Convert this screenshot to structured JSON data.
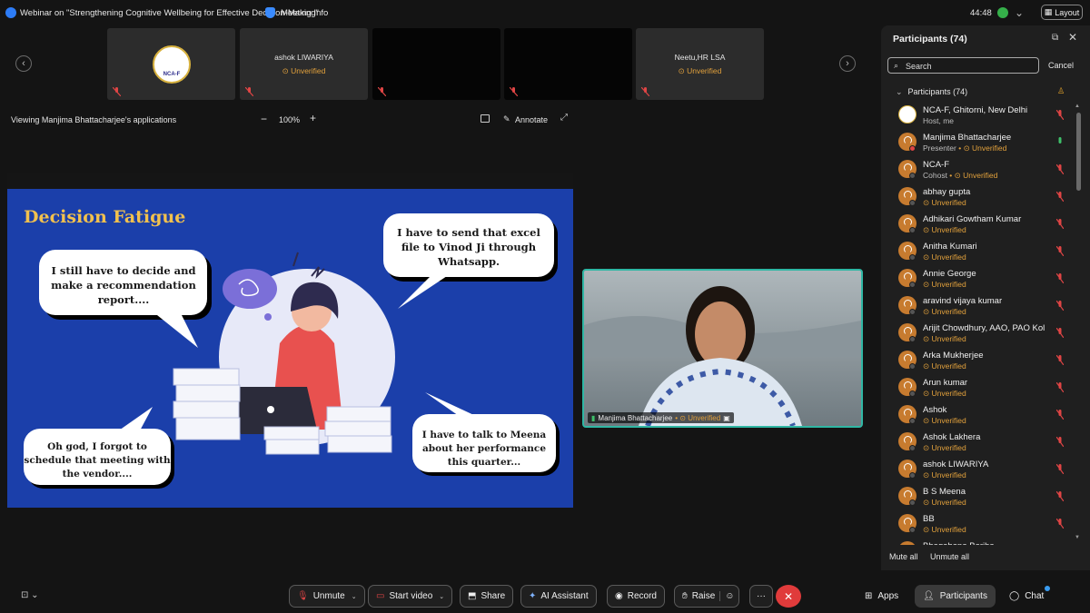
{
  "titlebar": {
    "webinar_title": "Webinar on \"Strengthening Cognitive Wellbeing for Effective Decision-Making\"",
    "meeting_info": "Meeting Info",
    "timer": "44:48",
    "layout_label": "Layout"
  },
  "filmstrip": {
    "tiles": [
      {
        "name": "",
        "status": "",
        "logo_text": "NCA-F"
      },
      {
        "name": "ashok LIWARIYA",
        "status": "Unverified"
      },
      {
        "name": "",
        "status": ""
      },
      {
        "name": "",
        "status": ""
      },
      {
        "name": "Neetu,HR LSA",
        "status": "Unverified"
      }
    ]
  },
  "viewbar": {
    "viewing_label": "Viewing Manjima Bhattacharjee's applications",
    "zoom": "100%",
    "annotate": "Annotate"
  },
  "slide": {
    "title": "Decision Fatigue",
    "bubble_top_left": [
      "I still have to decide and",
      "make a recommendation",
      "report...."
    ],
    "bubble_top_right": [
      "I have to send that excel",
      "file to Vinod Ji through",
      "Whatsapp."
    ],
    "bubble_bottom_left": [
      "Oh god, I forgot to",
      "schedule that meeting with",
      "the vendor...."
    ],
    "bubble_bottom_right": [
      "I have to talk to Meena",
      "about her performance",
      "this quarter..."
    ]
  },
  "presenter_video": {
    "name": "Manjima Bhattacharjee",
    "status": "Unverified"
  },
  "participants_panel": {
    "title": "Participants (74)",
    "search_placeholder": "Search",
    "cancel": "Cancel",
    "group_label": "Participants (74)",
    "mute_all": "Mute all",
    "unmute_all": "Unmute all",
    "items": [
      {
        "name": "NCA-F, Ghitorni, New Delhi",
        "role": "Host, me",
        "status": "",
        "host": true
      },
      {
        "name": "Manjima Bhattacharjee",
        "role": "Presenter",
        "status": "Unverified",
        "mic_on": true
      },
      {
        "name": "NCA-F",
        "role": "Cohost",
        "status": "Unverified"
      },
      {
        "name": "abhay gupta",
        "role": "",
        "status": "Unverified"
      },
      {
        "name": "Adhikari Gowtham Kumar",
        "role": "",
        "status": "Unverified"
      },
      {
        "name": "Anitha Kumari",
        "role": "",
        "status": "Unverified"
      },
      {
        "name": "Annie George",
        "role": "",
        "status": "Unverified"
      },
      {
        "name": "aravind vijaya kumar",
        "role": "",
        "status": "Unverified"
      },
      {
        "name": "Arijit Chowdhury, AAO, PAO Kol",
        "role": "",
        "status": "Unverified"
      },
      {
        "name": "Arka Mukherjee",
        "role": "",
        "status": "Unverified"
      },
      {
        "name": "Arun kumar",
        "role": "",
        "status": "Unverified"
      },
      {
        "name": "Ashok",
        "role": "",
        "status": "Unverified"
      },
      {
        "name": "Ashok Lakhera",
        "role": "",
        "status": "Unverified"
      },
      {
        "name": "ashok LIWARIYA",
        "role": "",
        "status": "Unverified"
      },
      {
        "name": "B S Meena",
        "role": "",
        "status": "Unverified"
      },
      {
        "name": "BB",
        "role": "",
        "status": "Unverified"
      },
      {
        "name": "Bhagabana Bariha",
        "role": "",
        "status": ""
      }
    ]
  },
  "controls": {
    "unmute": "Unmute",
    "start_video": "Start video",
    "share": "Share",
    "ai_assistant": "AI Assistant",
    "record": "Record",
    "raise": "Raise",
    "more": "···",
    "apps": "Apps",
    "participants": "Participants",
    "chat": "Chat"
  },
  "colors": {
    "accent_unverified": "#e2a13c",
    "slide_background": "#1b3faa",
    "slide_title": "#f2c14e",
    "end_call": "#e03b3b",
    "active_speaker_border": "#2fb7a4"
  }
}
